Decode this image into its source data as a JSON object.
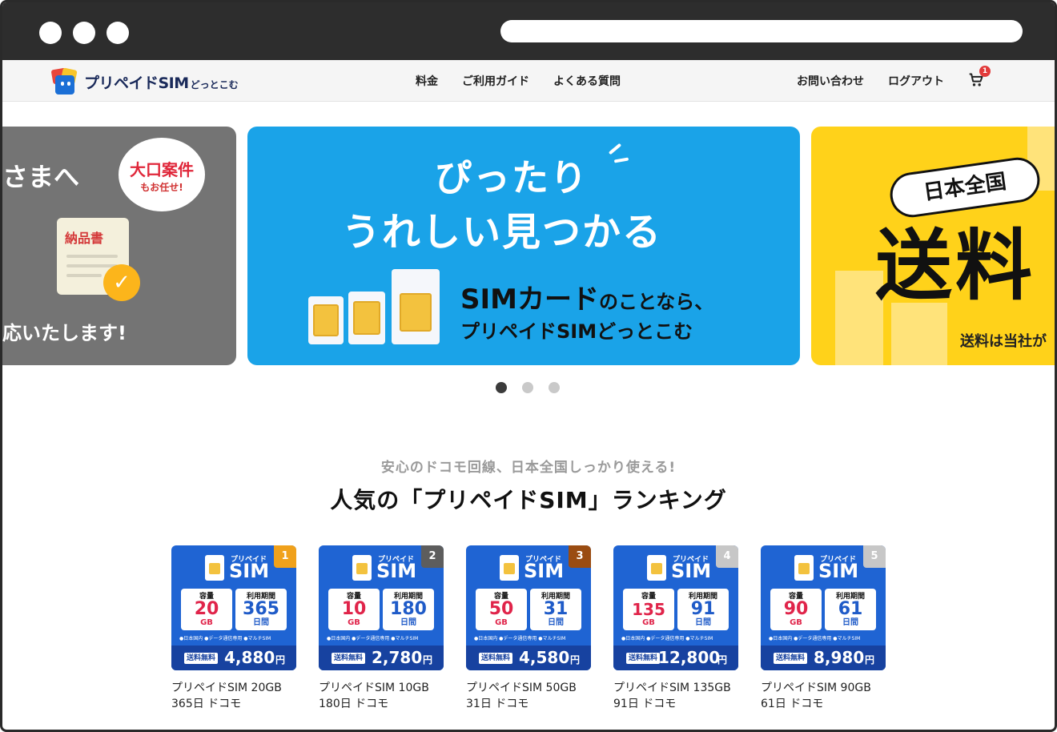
{
  "header": {
    "logo_text": "プリペイドSIM",
    "logo_sub": "どっとこむ",
    "nav_center": [
      "料金",
      "ご利用ガイド",
      "よくある質問"
    ],
    "nav_right": [
      "お問い合わせ",
      "ログアウト"
    ],
    "cart_count": "1"
  },
  "carousel": {
    "left_slide": {
      "text_top": "さまへ",
      "bubble_main": "大口案件",
      "bubble_sub": "もお任せ!",
      "doc_title": "納品書",
      "text_bottom": "応いたします!"
    },
    "main_slide": {
      "headline1": "ぴったり",
      "headline2": "うれしい見つかる",
      "line1_strong": "SIMカード",
      "line1_rest": "のことなら、",
      "line2": "プリペイドSIMどっとこむ"
    },
    "right_slide": {
      "tag": "日本全国",
      "big": "送料",
      "note": "送料は当社が"
    },
    "indicator_count": 3,
    "active_index": 0
  },
  "ranking": {
    "subtitle": "安心のドコモ回線、日本全国しっかり使える!",
    "title": "人気の「プリペイドSIM」ランキング",
    "card_labels": {
      "brand_sub": "プリペイド",
      "brand": "SIM",
      "capacity_label": "容量",
      "period_label": "利用期間",
      "capacity_unit": "GB",
      "period_unit": "日間",
      "features": "●日本国内 ●データ通信専用 ●マルチSIM",
      "shipping": "送料無料",
      "yen": "円"
    },
    "products": [
      {
        "rank": "1",
        "rank_color": "#f0a11b",
        "capacity": "20",
        "period": "365",
        "price": "4,880",
        "name_line1": "プリペイドSIM 20GB",
        "name_line2": "365日 ドコモ"
      },
      {
        "rank": "2",
        "rank_color": "#5d5d5d",
        "capacity": "10",
        "period": "180",
        "price": "2,780",
        "name_line1": "プリペイドSIM 10GB",
        "name_line2": "180日 ドコモ"
      },
      {
        "rank": "3",
        "rank_color": "#9a4c12",
        "capacity": "50",
        "period": "31",
        "price": "4,580",
        "name_line1": "プリペイドSIM 50GB",
        "name_line2": "31日 ドコモ"
      },
      {
        "rank": "4",
        "rank_color": "#c7c7c7",
        "capacity": "135",
        "period": "91",
        "price": "12,800",
        "name_line1": "プリペイドSIM 135GB",
        "name_line2": "91日 ドコモ"
      },
      {
        "rank": "5",
        "rank_color": "#c7c7c7",
        "capacity": "90",
        "period": "61",
        "price": "8,980",
        "name_line1": "プリペイドSIM 90GB",
        "name_line2": "61日 ドコモ"
      }
    ]
  }
}
